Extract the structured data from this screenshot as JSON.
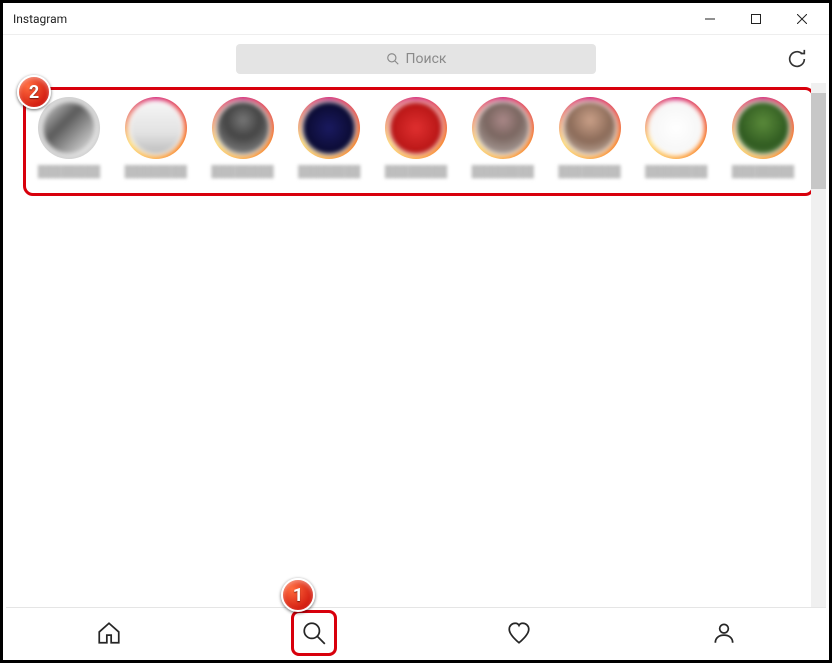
{
  "window": {
    "title": "Instagram"
  },
  "search": {
    "placeholder": "Поиск"
  },
  "stories": [
    {
      "username": "",
      "avatar_bg": "linear-gradient(135deg,#d8d8d8 0%,#5a5a5a 40%,#ededed 100%)",
      "ring_gray": true
    },
    {
      "username": "",
      "avatar_bg": "linear-gradient(180deg,#f5f5f5 0%,#e2e2e2 60%,#bdbdbd 100%)",
      "ring_gray": false
    },
    {
      "username": "",
      "avatar_bg": "radial-gradient(circle at 50% 35%,#777 0%,#444 40%,#9a9a9a 100%)",
      "ring_gray": false
    },
    {
      "username": "",
      "avatar_bg": "radial-gradient(circle at 50% 50%,#1a1a60 0%,#0a0a30 70%,#201040 100%)",
      "ring_gray": false
    },
    {
      "username": "",
      "avatar_bg": "radial-gradient(circle at 50% 50%,#e03030 0%,#b01010 80%)",
      "ring_gray": false
    },
    {
      "username": "",
      "avatar_bg": "radial-gradient(circle at 50% 35%,#a88 0%,#7a6660 40%,#bfb5b0 100%)",
      "ring_gray": false
    },
    {
      "username": "",
      "avatar_bg": "radial-gradient(circle at 50% 35%,#caa088 0%,#8a6a58 50%,#d5c5b8 100%)",
      "ring_gray": false
    },
    {
      "username": "",
      "avatar_bg": "radial-gradient(circle at 50% 50%,#fff 0%,#f2f2f2 100%)",
      "ring_gray": false
    },
    {
      "username": "",
      "avatar_bg": "radial-gradient(circle at 50% 40%,#5a8a3a 0%,#2f5a20 60%,#7aa060 100%)",
      "ring_gray": false
    }
  ],
  "callouts": {
    "stories_badge": "2",
    "search_badge": "1"
  }
}
